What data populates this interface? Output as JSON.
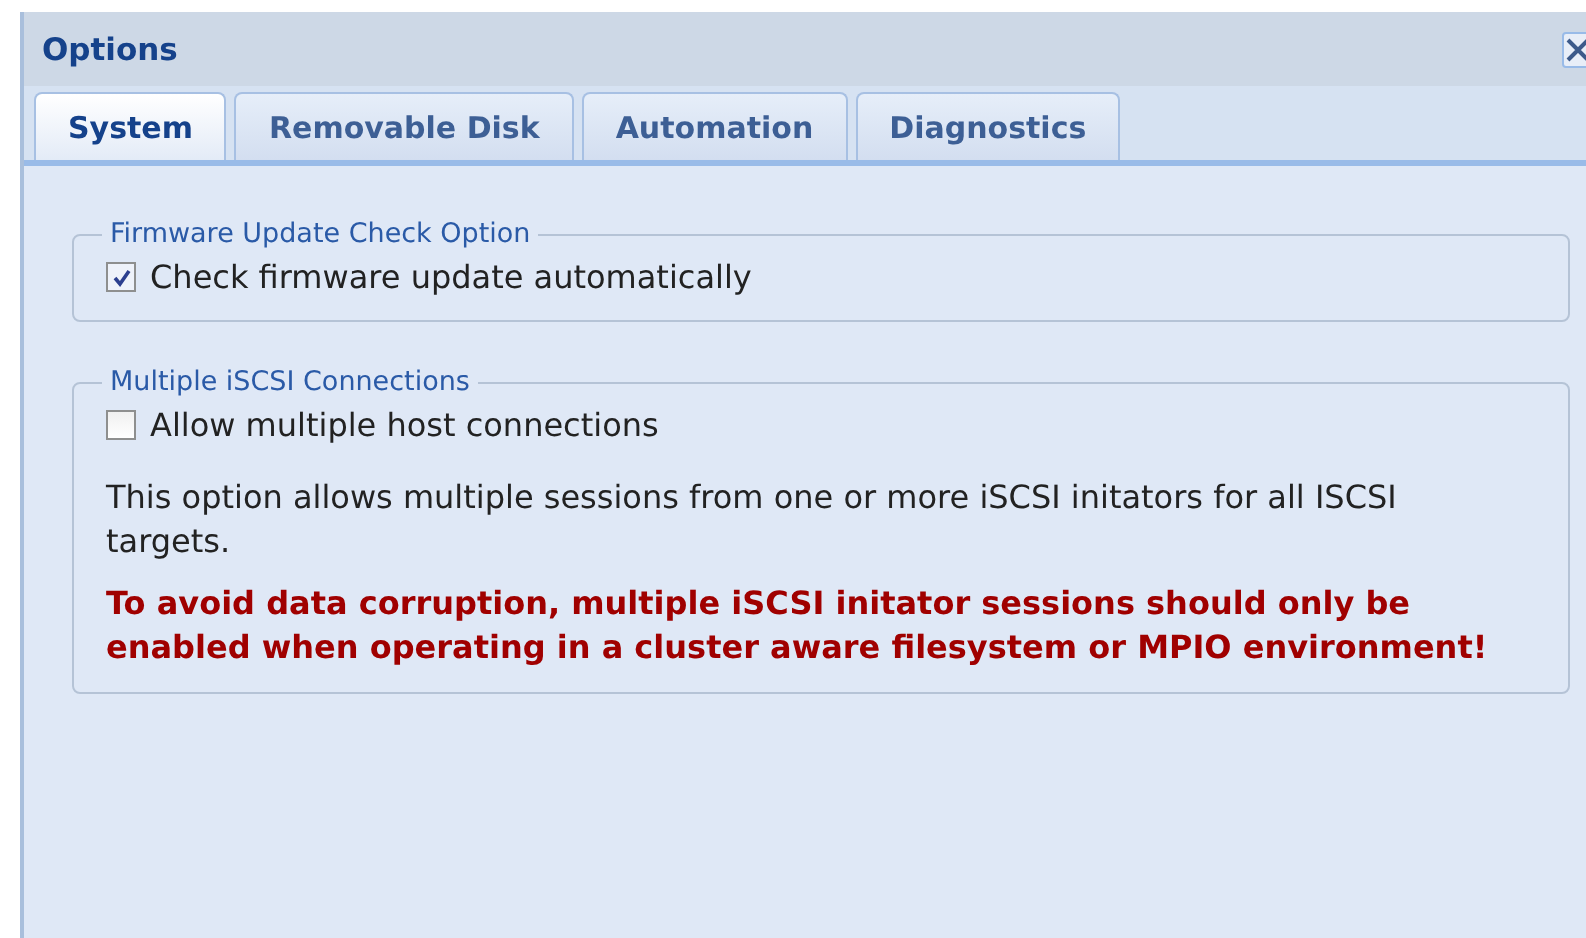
{
  "window": {
    "title": "Options"
  },
  "tabs": [
    {
      "label": "System",
      "selected": true
    },
    {
      "label": "Removable Disk",
      "selected": false
    },
    {
      "label": "Automation",
      "selected": false
    },
    {
      "label": "Diagnostics",
      "selected": false
    }
  ],
  "groups": [
    {
      "legend": "Firmware Update Check Option",
      "checkbox": {
        "label": "Check firmware update automatically",
        "checked": true
      }
    },
    {
      "legend": "Multiple iSCSI Connections",
      "checkbox": {
        "label": "Allow multiple host connections",
        "checked": false
      },
      "texts": [
        {
          "kind": "note",
          "text": "This option allows multiple sessions from one or more iSCSI initators for all ISCSI targets."
        },
        {
          "kind": "warning",
          "text": "To avoid data corruption, multiple iSCSI initator sessions should only be enabled when operating in a cluster aware filesystem or MPIO environment!"
        }
      ]
    }
  ]
}
